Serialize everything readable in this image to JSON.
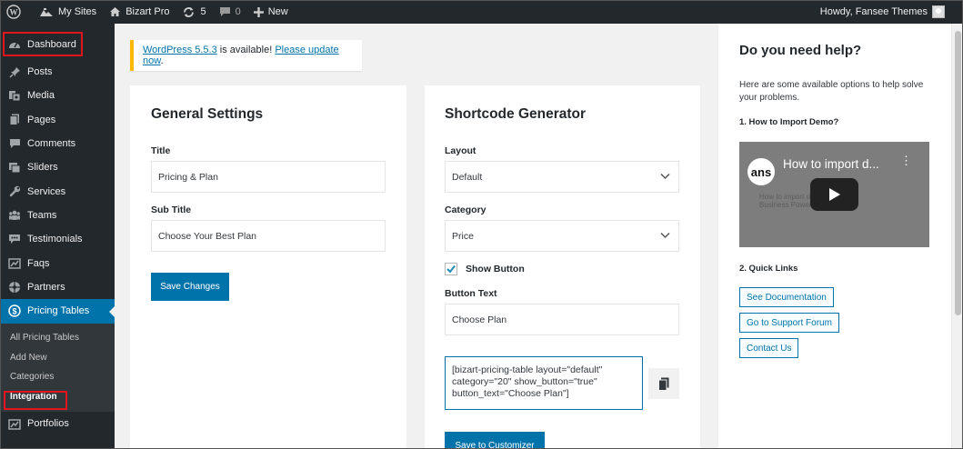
{
  "adminbar": {
    "my_sites": "My Sites",
    "site_name": "Bizart Pro",
    "updates_count": "5",
    "comments_count": "0",
    "new_label": "New",
    "howdy": "Howdy, Fansee Themes"
  },
  "sidebar": {
    "items": [
      {
        "label": "Dashboard",
        "icon": "dashboard-icon"
      },
      {
        "label": "Posts",
        "icon": "pin-icon"
      },
      {
        "label": "Media",
        "icon": "media-icon"
      },
      {
        "label": "Pages",
        "icon": "pages-icon"
      },
      {
        "label": "Comments",
        "icon": "comment-icon"
      },
      {
        "label": "Sliders",
        "icon": "slides-icon"
      },
      {
        "label": "Services",
        "icon": "wrench-icon"
      },
      {
        "label": "Teams",
        "icon": "groups-icon"
      },
      {
        "label": "Testimonials",
        "icon": "testimonial-icon"
      },
      {
        "label": "Faqs",
        "icon": "faq-icon"
      },
      {
        "label": "Partners",
        "icon": "partners-icon"
      },
      {
        "label": "Pricing Tables",
        "icon": "dollar-icon"
      }
    ],
    "submenu": [
      "All Pricing Tables",
      "Add New",
      "Categories",
      "Integration"
    ],
    "after": {
      "label": "Portfolios",
      "icon": "portfolio-icon"
    }
  },
  "notice": {
    "version_link": "WordPress 5.5.3",
    "text": " is available! ",
    "update_link": "Please update now",
    "end": "."
  },
  "general": {
    "title": "General Settings",
    "title_label": "Title",
    "title_value": "Pricing & Plan",
    "subtitle_label": "Sub Title",
    "subtitle_value": "Choose Your Best Plan",
    "save_label": "Save Changes"
  },
  "generator": {
    "title": "Shortcode Generator",
    "layout_label": "Layout",
    "layout_value": "Default",
    "category_label": "Category",
    "category_value": "Price",
    "show_button_label": "Show Button",
    "show_button_checked": true,
    "button_text_label": "Button Text",
    "button_text_value": "Choose Plan",
    "shortcode": "[bizart-pricing-table layout=\"default\" category=\"20\" show_button=\"true\" button_text=\"Choose Plan\"]",
    "save_customizer_label": "Save to Customizer"
  },
  "help": {
    "title": "Do you need help?",
    "intro": "Here are some available options to help solve your problems.",
    "import_heading": "1. How to Import Demo?",
    "video_title": "How to import d...",
    "video_logo": "ans",
    "video_bg_text": "How to import demo data with Business Power",
    "quick_links_heading": "2. Quick Links",
    "links": [
      "See Documentation",
      "Go to Support Forum",
      "Contact Us"
    ]
  },
  "colors": {
    "accent": "#0073aa",
    "admin_dark": "#23282d",
    "highlight": "#e0161e",
    "notice_warning": "#ffb900"
  }
}
